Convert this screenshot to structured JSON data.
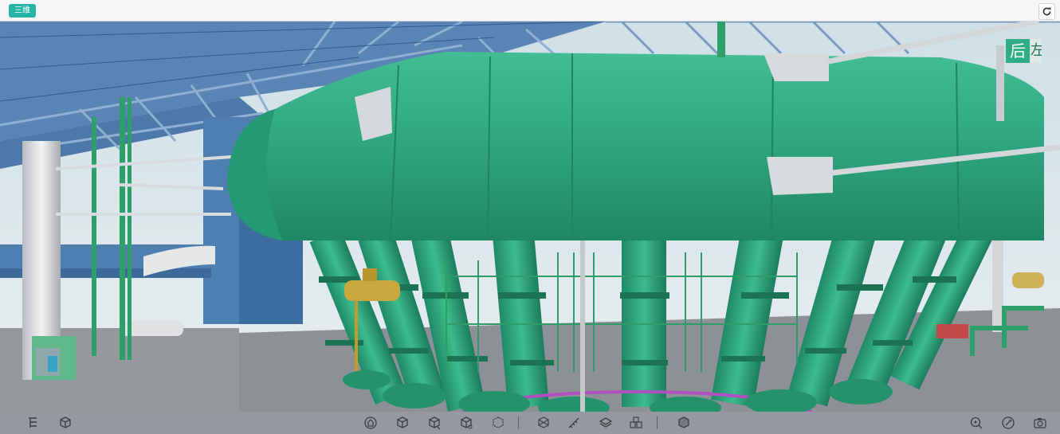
{
  "header": {
    "mode_label": "三维"
  },
  "viewcube": {
    "face_label": "后",
    "edge_label": "左"
  },
  "toolbar": {
    "left": [
      "model-tree-icon",
      "component-cube-icon"
    ],
    "center": [
      "home-view-icon",
      "cube-view-icon",
      "cube-section-icon",
      "cube-explode-icon",
      "cube-transparent-icon",
      "cube-wireframe-icon",
      "measure-icon",
      "layer-icon",
      "component-group-icon",
      "isolate-icon"
    ],
    "right": [
      "search-location-icon",
      "edit-markup-icon",
      "screenshot-camera-icon"
    ]
  },
  "colors": {
    "accent": "#27b3a6",
    "vessel": "#2aa27c",
    "steel": "#5c86b4",
    "floor": "#8f9296"
  }
}
